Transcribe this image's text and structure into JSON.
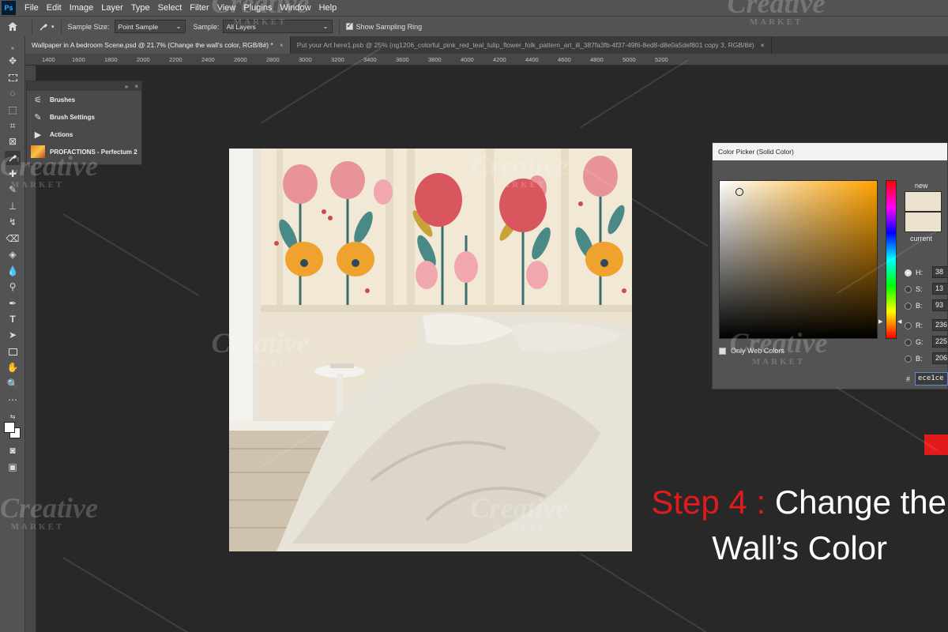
{
  "app": {
    "logo": "Ps"
  },
  "menubar": {
    "items": [
      "File",
      "Edit",
      "Image",
      "Layer",
      "Type",
      "Select",
      "Filter",
      "View",
      "Plugins",
      "Window",
      "Help"
    ]
  },
  "options_bar": {
    "sample_size_label": "Sample Size:",
    "sample_size_value": "Point Sample",
    "sample_label": "Sample:",
    "sample_value": "All Layers",
    "show_sampling_ring_label": "Show Sampling Ring",
    "show_sampling_ring_checked": true
  },
  "tabs": [
    {
      "label": "Wallpaper in A bedroom Scene.psd @ 21.7% (Change the wall's color, RGB/8#) *",
      "active": true
    },
    {
      "label": "Put your Art here1.psb @ 25% (ng1206_colorful_pink_red_teal_tulip_flower_folk_pattern_art_ill_387fa3fb-4f37-49f6-8ed8-d8e0a5def801 copy 3, RGB/8#)",
      "active": false
    }
  ],
  "ruler": {
    "top_ticks": [
      "1400",
      "1600",
      "1800",
      "2000",
      "2200",
      "2400",
      "2600",
      "2800",
      "3000",
      "3200",
      "3400",
      "3600",
      "3800",
      "4000",
      "4200",
      "4400",
      "4600",
      "4800",
      "5000",
      "5200"
    ]
  },
  "panel": {
    "items": [
      {
        "label": "Brushes",
        "icon": "brushes-icon"
      },
      {
        "label": "Brush Settings",
        "icon": "brush-settings-icon"
      },
      {
        "label": "Actions",
        "icon": "actions-play-icon"
      },
      {
        "label": "PROFACTIONS - Perfectum 2",
        "icon": "profactions-thumbnail"
      }
    ]
  },
  "color_picker": {
    "title": "Color Picker (Solid Color)",
    "new_label": "new",
    "current_label": "current",
    "new_color": "#ece1ce",
    "current_color": "#ece1ce",
    "only_web_colors_label": "Only Web Colors",
    "fields": [
      {
        "label": "H:",
        "value": "38",
        "selected": true
      },
      {
        "label": "S:",
        "value": "13",
        "selected": false
      },
      {
        "label": "B:",
        "value": "93",
        "selected": false
      },
      {
        "label": "R:",
        "value": "236",
        "selected": false
      },
      {
        "label": "G:",
        "value": "225",
        "selected": false
      },
      {
        "label": "B:",
        "value": "206",
        "selected": false
      }
    ],
    "hex_label": "#",
    "hex_value": "ece1ce"
  },
  "overlay": {
    "step_label": "Step 4 :",
    "title_line1": "Change the",
    "title_line2": "Wall’s Color"
  },
  "watermark": {
    "line1": "Creative",
    "line2": "MARKET"
  },
  "colors": {
    "step_red": "#e11b1b",
    "accent_red": "#e11b1b"
  }
}
